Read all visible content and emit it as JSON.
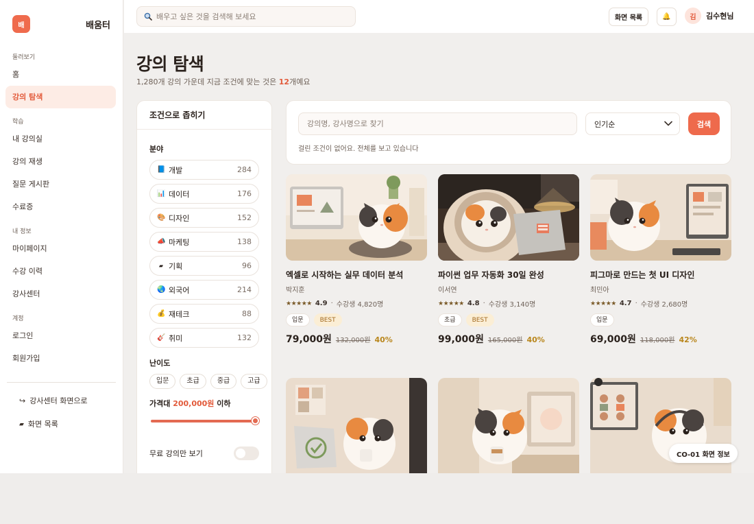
{
  "app": {
    "logo_mark": "배",
    "name": "배움터"
  },
  "topbar": {
    "search_placeholder": "배우고 싶은 것을 검색해 보세요",
    "screen_list_label": "화면 목록",
    "bell_glyph": "🔔",
    "user_initial": "김",
    "user_name": "김수현님"
  },
  "sidebar": {
    "sections": {
      "browse": "둘러보기",
      "learn": "학습",
      "mine": "내 정보",
      "account": "계정"
    },
    "items": {
      "home": "홈",
      "explore": "강의 탐색",
      "my_classroom": "내 강의실",
      "replay": "강의 재생",
      "qna": "질문 게시판",
      "certificate": "수료증",
      "mypage": "마이페이지",
      "history": "수강 이력",
      "instructor_center": "강사센터",
      "login": "로그인",
      "signup": "회원가입"
    },
    "footer": {
      "to_instructor": "강사센터 화면으로",
      "to_instructor_glyph": "↪",
      "screen_list": "화면 목록",
      "screen_list_glyph": "▰"
    }
  },
  "page": {
    "title": "강의 탐색",
    "subtitle_pre": "1,280개 강의 가운데 지금 조건에 맞는 것은 ",
    "subtitle_num": "12",
    "subtitle_post": "개예요"
  },
  "filter": {
    "title": "조건으로 좁히기",
    "category_label": "분야",
    "categories": [
      {
        "icon": "📘",
        "label": "개발",
        "count": "284"
      },
      {
        "icon": "📊",
        "label": "데이터",
        "count": "176"
      },
      {
        "icon": "🎨",
        "label": "디자인",
        "count": "152"
      },
      {
        "icon": "📣",
        "label": "마케팅",
        "count": "138"
      },
      {
        "icon": "▰",
        "label": "기획",
        "count": "96"
      },
      {
        "icon": "🌏",
        "label": "외국어",
        "count": "214"
      },
      {
        "icon": "💰",
        "label": "재테크",
        "count": "88"
      },
      {
        "icon": "🎸",
        "label": "취미",
        "count": "132"
      }
    ],
    "level_label": "난이도",
    "levels": [
      "입문",
      "초급",
      "중급",
      "고급"
    ],
    "price_pre": "가격대 ",
    "price_value": "200,000원",
    "price_post": " 이하",
    "price_fraction": 1.0,
    "free_only_label": "무료 강의만 보기",
    "free_only": false
  },
  "search": {
    "placeholder": "강의명, 강사명으로 찾기",
    "sort_value": "인기순",
    "button": "검색",
    "note": "걸린 조건이 없어요. 전체를 보고 있습니다"
  },
  "courses": [
    {
      "title": "엑셀로 시작하는 실무 데이터 분석",
      "author": "박지훈",
      "stars": "★★★★★",
      "rating": "4.9",
      "students": "수강생 4,820명",
      "tags": [
        "입문",
        "BEST"
      ],
      "price": "79,000원",
      "original": "132,000원",
      "discount": "40%"
    },
    {
      "title": "파이썬 업무 자동화 30일 완성",
      "author": "이서연",
      "stars": "★★★★★",
      "rating": "4.8",
      "students": "수강생 3,140명",
      "tags": [
        "초급",
        "BEST"
      ],
      "price": "99,000원",
      "original": "165,000원",
      "discount": "40%"
    },
    {
      "title": "피그마로 만드는 첫 UI 디자인",
      "author": "최민아",
      "stars": "★★★★★",
      "rating": "4.7",
      "students": "수강생 2,680명",
      "tags": [
        "입문"
      ],
      "price": "69,000원",
      "original": "118,000원",
      "discount": "42%"
    }
  ],
  "rating_sep": "·",
  "screen_chip": "CO-01 화면 정보",
  "colors": {
    "accent": "#ee6a4c",
    "accent_soft": "#fdece5",
    "best_bg": "#fbeed5",
    "discount": "#b9861c"
  }
}
